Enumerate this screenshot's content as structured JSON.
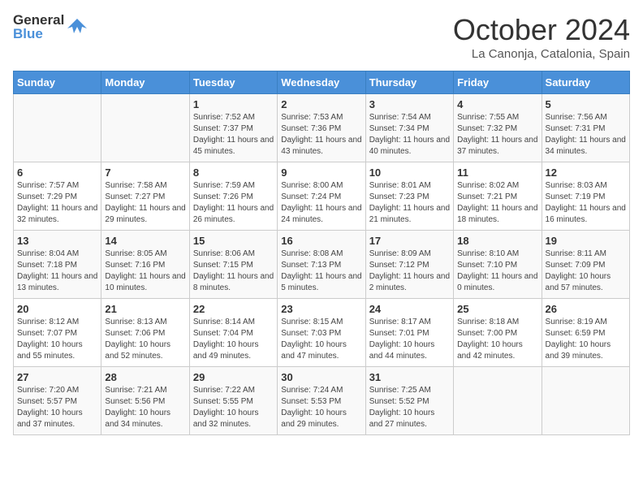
{
  "logo": {
    "general": "General",
    "blue": "Blue"
  },
  "header": {
    "month": "October 2024",
    "location": "La Canonja, Catalonia, Spain"
  },
  "weekdays": [
    "Sunday",
    "Monday",
    "Tuesday",
    "Wednesday",
    "Thursday",
    "Friday",
    "Saturday"
  ],
  "weeks": [
    [
      {
        "day": "",
        "info": ""
      },
      {
        "day": "",
        "info": ""
      },
      {
        "day": "1",
        "info": "Sunrise: 7:52 AM\nSunset: 7:37 PM\nDaylight: 11 hours and 45 minutes."
      },
      {
        "day": "2",
        "info": "Sunrise: 7:53 AM\nSunset: 7:36 PM\nDaylight: 11 hours and 43 minutes."
      },
      {
        "day": "3",
        "info": "Sunrise: 7:54 AM\nSunset: 7:34 PM\nDaylight: 11 hours and 40 minutes."
      },
      {
        "day": "4",
        "info": "Sunrise: 7:55 AM\nSunset: 7:32 PM\nDaylight: 11 hours and 37 minutes."
      },
      {
        "day": "5",
        "info": "Sunrise: 7:56 AM\nSunset: 7:31 PM\nDaylight: 11 hours and 34 minutes."
      }
    ],
    [
      {
        "day": "6",
        "info": "Sunrise: 7:57 AM\nSunset: 7:29 PM\nDaylight: 11 hours and 32 minutes."
      },
      {
        "day": "7",
        "info": "Sunrise: 7:58 AM\nSunset: 7:27 PM\nDaylight: 11 hours and 29 minutes."
      },
      {
        "day": "8",
        "info": "Sunrise: 7:59 AM\nSunset: 7:26 PM\nDaylight: 11 hours and 26 minutes."
      },
      {
        "day": "9",
        "info": "Sunrise: 8:00 AM\nSunset: 7:24 PM\nDaylight: 11 hours and 24 minutes."
      },
      {
        "day": "10",
        "info": "Sunrise: 8:01 AM\nSunset: 7:23 PM\nDaylight: 11 hours and 21 minutes."
      },
      {
        "day": "11",
        "info": "Sunrise: 8:02 AM\nSunset: 7:21 PM\nDaylight: 11 hours and 18 minutes."
      },
      {
        "day": "12",
        "info": "Sunrise: 8:03 AM\nSunset: 7:19 PM\nDaylight: 11 hours and 16 minutes."
      }
    ],
    [
      {
        "day": "13",
        "info": "Sunrise: 8:04 AM\nSunset: 7:18 PM\nDaylight: 11 hours and 13 minutes."
      },
      {
        "day": "14",
        "info": "Sunrise: 8:05 AM\nSunset: 7:16 PM\nDaylight: 11 hours and 10 minutes."
      },
      {
        "day": "15",
        "info": "Sunrise: 8:06 AM\nSunset: 7:15 PM\nDaylight: 11 hours and 8 minutes."
      },
      {
        "day": "16",
        "info": "Sunrise: 8:08 AM\nSunset: 7:13 PM\nDaylight: 11 hours and 5 minutes."
      },
      {
        "day": "17",
        "info": "Sunrise: 8:09 AM\nSunset: 7:12 PM\nDaylight: 11 hours and 2 minutes."
      },
      {
        "day": "18",
        "info": "Sunrise: 8:10 AM\nSunset: 7:10 PM\nDaylight: 11 hours and 0 minutes."
      },
      {
        "day": "19",
        "info": "Sunrise: 8:11 AM\nSunset: 7:09 PM\nDaylight: 10 hours and 57 minutes."
      }
    ],
    [
      {
        "day": "20",
        "info": "Sunrise: 8:12 AM\nSunset: 7:07 PM\nDaylight: 10 hours and 55 minutes."
      },
      {
        "day": "21",
        "info": "Sunrise: 8:13 AM\nSunset: 7:06 PM\nDaylight: 10 hours and 52 minutes."
      },
      {
        "day": "22",
        "info": "Sunrise: 8:14 AM\nSunset: 7:04 PM\nDaylight: 10 hours and 49 minutes."
      },
      {
        "day": "23",
        "info": "Sunrise: 8:15 AM\nSunset: 7:03 PM\nDaylight: 10 hours and 47 minutes."
      },
      {
        "day": "24",
        "info": "Sunrise: 8:17 AM\nSunset: 7:01 PM\nDaylight: 10 hours and 44 minutes."
      },
      {
        "day": "25",
        "info": "Sunrise: 8:18 AM\nSunset: 7:00 PM\nDaylight: 10 hours and 42 minutes."
      },
      {
        "day": "26",
        "info": "Sunrise: 8:19 AM\nSunset: 6:59 PM\nDaylight: 10 hours and 39 minutes."
      }
    ],
    [
      {
        "day": "27",
        "info": "Sunrise: 7:20 AM\nSunset: 5:57 PM\nDaylight: 10 hours and 37 minutes."
      },
      {
        "day": "28",
        "info": "Sunrise: 7:21 AM\nSunset: 5:56 PM\nDaylight: 10 hours and 34 minutes."
      },
      {
        "day": "29",
        "info": "Sunrise: 7:22 AM\nSunset: 5:55 PM\nDaylight: 10 hours and 32 minutes."
      },
      {
        "day": "30",
        "info": "Sunrise: 7:24 AM\nSunset: 5:53 PM\nDaylight: 10 hours and 29 minutes."
      },
      {
        "day": "31",
        "info": "Sunrise: 7:25 AM\nSunset: 5:52 PM\nDaylight: 10 hours and 27 minutes."
      },
      {
        "day": "",
        "info": ""
      },
      {
        "day": "",
        "info": ""
      }
    ]
  ]
}
